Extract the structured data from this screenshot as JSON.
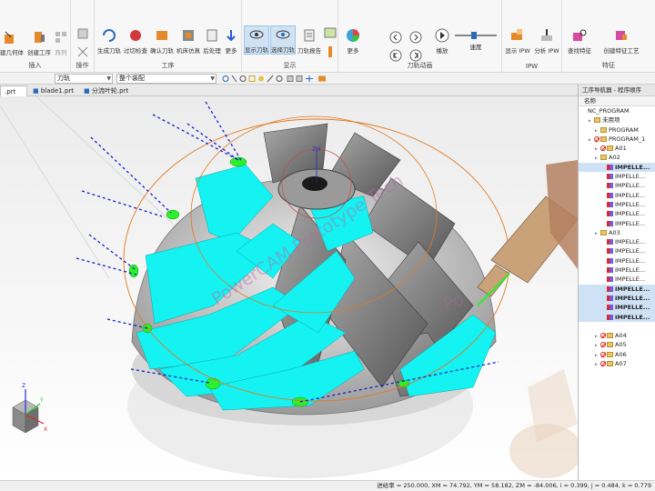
{
  "ribbon": {
    "insert": {
      "label": "插入",
      "buttons": [
        "建几何体",
        "创建工序",
        "阵列"
      ]
    },
    "operation": {
      "label": "操作"
    },
    "process": {
      "label": "工序",
      "buttons": [
        "生成刀轨",
        "过切检查",
        "确认刀轨",
        "机床仿真",
        "后处理",
        "更多"
      ]
    },
    "display": {
      "label": "显示",
      "buttons": [
        "显示刀轨",
        "选择刀轨",
        "刀轨报告"
      ]
    },
    "toolpath_anim": {
      "label": "刀轨动画",
      "buttons": [
        "播放"
      ],
      "speed_label": "速度",
      "more": "更多"
    },
    "ipw": {
      "label": "IPW",
      "buttons": [
        "显示 IPW",
        "分析 IPW"
      ]
    },
    "feature": {
      "label": "特征",
      "buttons": [
        "查找特征",
        "创建特征工艺"
      ]
    }
  },
  "toolbar": {
    "filter_value": "刀轨",
    "scope_value": "整个装配"
  },
  "tabs": [
    {
      "label": ".prt",
      "active": true
    },
    {
      "label": "blade1.prt",
      "active": false
    },
    {
      "label": "分流叶轮.prt",
      "active": false
    }
  ],
  "viewport": {
    "watermark": "PowerCAM Prototype Tech",
    "watermark2": "Po",
    "triad": {
      "x": "X",
      "y": "Y",
      "z": "Z"
    },
    "center_label": "ZM"
  },
  "navigator": {
    "title": "工序导航器 - 程序顺序",
    "column": "名称",
    "rows": [
      {
        "label": "NC_PROGRAM",
        "indent": 0,
        "icon": "none",
        "state": ""
      },
      {
        "label": "未用项",
        "indent": 1,
        "icon": "folder",
        "state": ""
      },
      {
        "label": "PROGRAM",
        "indent": 2,
        "icon": "folder",
        "state": ""
      },
      {
        "label": "PROGRAM_1",
        "indent": 1,
        "icon": "folder",
        "state": "noc"
      },
      {
        "label": "A01",
        "indent": 2,
        "icon": "folder",
        "state": "noc"
      },
      {
        "label": "A02",
        "indent": 2,
        "icon": "folder",
        "state": ""
      },
      {
        "label": "IMPELLE...",
        "indent": 3,
        "icon": "op",
        "state": "sel"
      },
      {
        "label": "IMPELLE...",
        "indent": 3,
        "icon": "op",
        "state": ""
      },
      {
        "label": "IMPELLE...",
        "indent": 3,
        "icon": "op",
        "state": ""
      },
      {
        "label": "IMPELLE...",
        "indent": 3,
        "icon": "op",
        "state": ""
      },
      {
        "label": "IMPELLE...",
        "indent": 3,
        "icon": "op",
        "state": ""
      },
      {
        "label": "IMPELLE...",
        "indent": 3,
        "icon": "op",
        "state": ""
      },
      {
        "label": "IMPELLE...",
        "indent": 3,
        "icon": "op",
        "state": ""
      },
      {
        "label": "A03",
        "indent": 2,
        "icon": "folder",
        "state": ""
      },
      {
        "label": "IMPELLE...",
        "indent": 3,
        "icon": "op",
        "state": ""
      },
      {
        "label": "IMPELLE...",
        "indent": 3,
        "icon": "op",
        "state": ""
      },
      {
        "label": "IMPELLE...",
        "indent": 3,
        "icon": "op",
        "state": ""
      },
      {
        "label": "IMPELLE...",
        "indent": 3,
        "icon": "op",
        "state": ""
      },
      {
        "label": "IMPELLE...",
        "indent": 3,
        "icon": "op",
        "state": ""
      },
      {
        "label": "IMPELLE...",
        "indent": 3,
        "icon": "op",
        "state": "sel"
      },
      {
        "label": "IMPELLE...",
        "indent": 3,
        "icon": "op",
        "state": "sel"
      },
      {
        "label": "IMPELLE...",
        "indent": 3,
        "icon": "op",
        "state": "sel"
      },
      {
        "label": "IMPELLE...",
        "indent": 3,
        "icon": "op",
        "state": "sel"
      },
      {
        "label": "",
        "indent": 3,
        "icon": "none",
        "state": ""
      },
      {
        "label": "A04",
        "indent": 2,
        "icon": "folder",
        "state": "noc"
      },
      {
        "label": "A05",
        "indent": 2,
        "icon": "folder",
        "state": "noc"
      },
      {
        "label": "A06",
        "indent": 2,
        "icon": "folder",
        "state": "noc"
      },
      {
        "label": "A07",
        "indent": 2,
        "icon": "folder",
        "state": "noc"
      }
    ]
  },
  "status": {
    "text": "进给率 = 250.000, XM = 74.792, YM = 58.182, ZM = -84.006, i = 0.399, j = 0.484, k = 0.779"
  },
  "colors": {
    "cyan": "#14f2f2",
    "green": "#2bf02b",
    "orange": "#e07a22",
    "blue_dash": "#1420c8"
  }
}
